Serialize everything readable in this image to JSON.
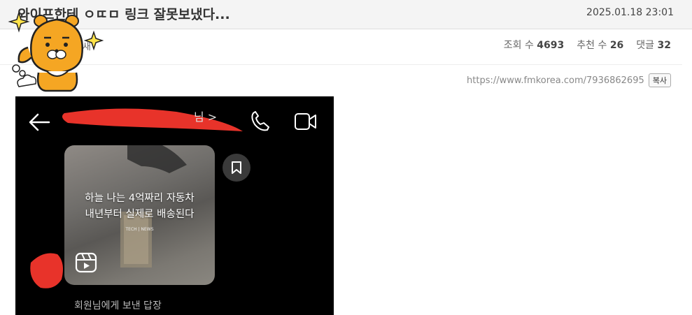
{
  "post": {
    "title": "와이프한테 ㅇㄸㅁ 링크 잘못보냈다...",
    "date": "2025.01.18 23:01",
    "author_fragment": "새",
    "views_label": "조회 수",
    "views": "4693",
    "likes_label": "추천 수",
    "likes": "26",
    "comments_label": "댓글",
    "comments": "32",
    "url": "https://www.fmkorea.com/7936862695",
    "copy_label": "복사"
  },
  "screenshot": {
    "chat_name_fragment": "님 >",
    "card_line1": "하늘 나는 4억짜리 자동차",
    "card_line2": "내년부터 실제로 배송된다",
    "card_tag": "TECH | NEWS",
    "reply_text": "회원님에게 보낸 답장"
  },
  "icons": [
    "back-arrow-icon",
    "phone-icon",
    "video-call-icon",
    "bookmark-icon",
    "reels-icon",
    "sparkle-icon"
  ],
  "colors": {
    "header_bg": "#f4f4f4",
    "redaction": "#e8332a",
    "sticker": "#f5a623"
  }
}
